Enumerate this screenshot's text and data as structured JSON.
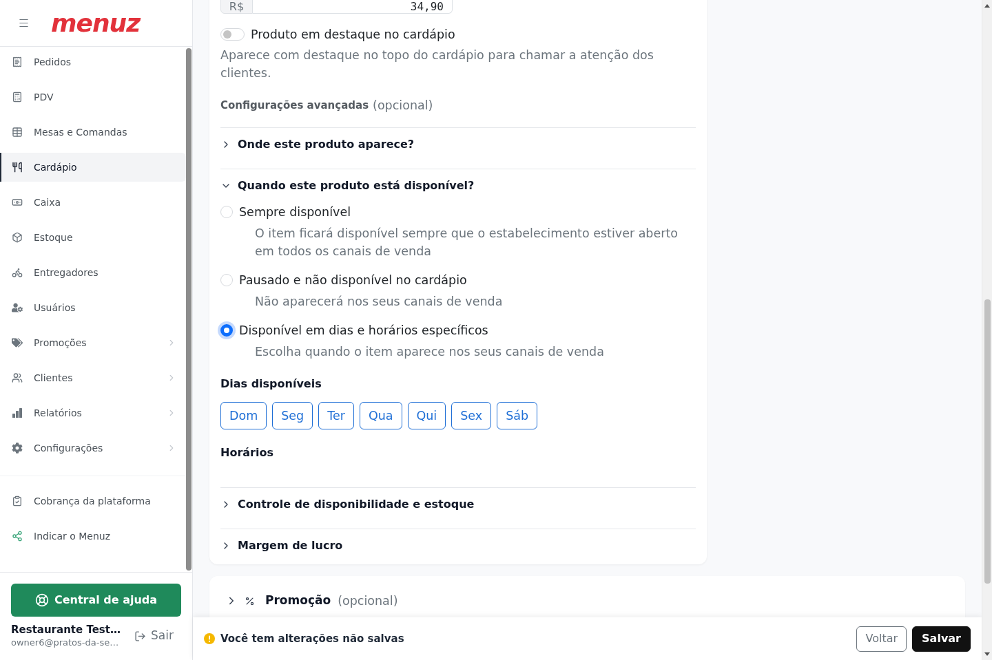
{
  "sidebar": {
    "logo": "menuz",
    "nav_items": [
      {
        "label": "Pedidos",
        "selected": false,
        "has_submenu": false
      },
      {
        "label": "PDV",
        "selected": false,
        "has_submenu": false
      },
      {
        "label": "Mesas e Comandas",
        "selected": false,
        "has_submenu": false
      },
      {
        "label": "Cardápio",
        "selected": true,
        "has_submenu": false
      },
      {
        "label": "Caixa",
        "selected": false,
        "has_submenu": false
      },
      {
        "label": "Estoque",
        "selected": false,
        "has_submenu": false
      },
      {
        "label": "Entregadores",
        "selected": false,
        "has_submenu": false
      },
      {
        "label": "Usuários",
        "selected": false,
        "has_submenu": false
      },
      {
        "label": "Promoções",
        "selected": false,
        "has_submenu": true
      },
      {
        "label": "Clientes",
        "selected": false,
        "has_submenu": true
      },
      {
        "label": "Relatórios",
        "selected": false,
        "has_submenu": true
      },
      {
        "label": "Configurações",
        "selected": false,
        "has_submenu": true
      }
    ],
    "extra_items": [
      {
        "label": "Cobrança da plataforma",
        "selected": false
      },
      {
        "label": "Indicar o Menuz",
        "selected": false
      }
    ],
    "help_button": {
      "label": "Central de ajuda"
    },
    "account": {
      "name": "Restaurante Test…",
      "email": "owner6@pratos-da-se…",
      "logout": "Sair"
    }
  },
  "product_form": {
    "price_field": {
      "prefix": "R$",
      "value": "34,90"
    },
    "featured_toggle": {
      "label": "Produto em destaque no cardápio",
      "on": false,
      "description": "Aparece com destaque no topo do cardápio para chamar a atenção dos clientes."
    },
    "advanced_settings": {
      "title": "Configurações avançadas",
      "note": "(opcional)"
    },
    "sections": [
      {
        "title": "Onde este produto aparece?",
        "expanded": false
      },
      {
        "title": "Quando este produto está disponível?",
        "expanded": true,
        "availability_options": [
          {
            "label": "Sempre disponível",
            "description": "O item ficará disponível sempre que o estabelecimento estiver aberto em todos os canais de venda",
            "selected": false
          },
          {
            "label": "Pausado e não disponível no cardápio",
            "description": "Não aparecerá nos seus canais de venda",
            "selected": false
          },
          {
            "label": "Disponível em dias e horários específicos",
            "description": "Escolha quando o item aparece nos seus canais de venda",
            "selected": true
          }
        ],
        "days_label": "Dias disponíveis",
        "days": [
          {
            "label": "Dom",
            "selected": false
          },
          {
            "label": "Seg",
            "selected": false
          },
          {
            "label": "Ter",
            "selected": false
          },
          {
            "label": "Qua",
            "selected": false
          },
          {
            "label": "Qui",
            "selected": false
          },
          {
            "label": "Sex",
            "selected": false
          },
          {
            "label": "Sáb",
            "selected": false
          }
        ],
        "hours_label": "Horários"
      },
      {
        "title": "Controle de disponibilidade e estoque",
        "expanded": false
      },
      {
        "title": "Margem de lucro",
        "expanded": false
      }
    ]
  },
  "promotion_section": {
    "title": "Promoção",
    "note": "(opcional)",
    "expanded": false
  },
  "unsaved_bar": {
    "message": "Você tem alterações não salvas",
    "buttons": [
      {
        "label": "Voltar",
        "kind": "secondary"
      },
      {
        "label": "Salvar",
        "kind": "primary"
      }
    ]
  }
}
